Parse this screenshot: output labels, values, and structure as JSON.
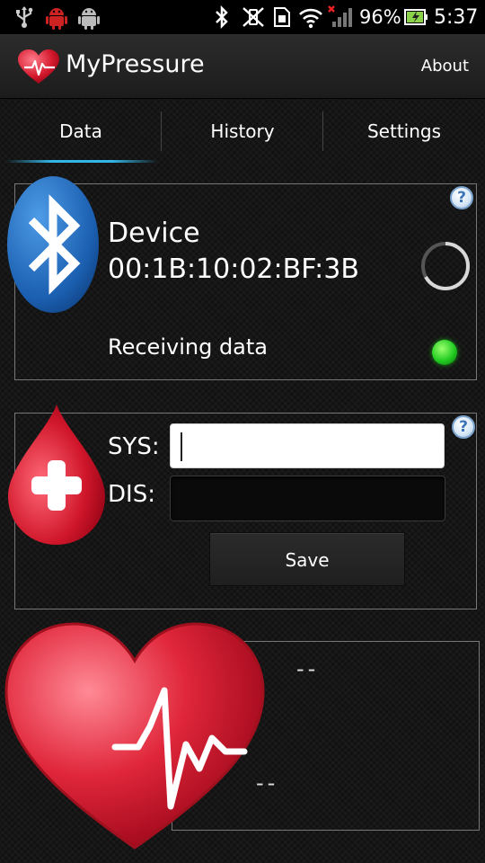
{
  "status_bar": {
    "battery": "96%",
    "time": "5:37",
    "icons": [
      "usb-icon",
      "android-debug-icon",
      "android-icon",
      "bluetooth-icon",
      "vibrate-icon",
      "sim-icon",
      "wifi-icon",
      "signal-icon",
      "battery-icon"
    ]
  },
  "app": {
    "title": "MyPressure",
    "about_label": "About"
  },
  "tabs": [
    {
      "label": "Data",
      "selected": true
    },
    {
      "label": "History",
      "selected": false
    },
    {
      "label": "Settings",
      "selected": false
    }
  ],
  "device_panel": {
    "device_label": "Device",
    "address": "00:1B:10:02:BF:3B",
    "status": "Receiving data",
    "status_color": "#22cc22",
    "help_label": "?"
  },
  "input_panel": {
    "sys_label": "SYS:",
    "sys_value": "",
    "dis_label": "DIS:",
    "dis_value": "",
    "save_label": "Save",
    "help_label": "?"
  },
  "result_panel": {
    "value_top": "--",
    "value_bottom": "--"
  },
  "colors": {
    "accent": "#33b5e5",
    "heart_red": "#d0162a",
    "bluetooth_blue": "#1b5fb0"
  }
}
